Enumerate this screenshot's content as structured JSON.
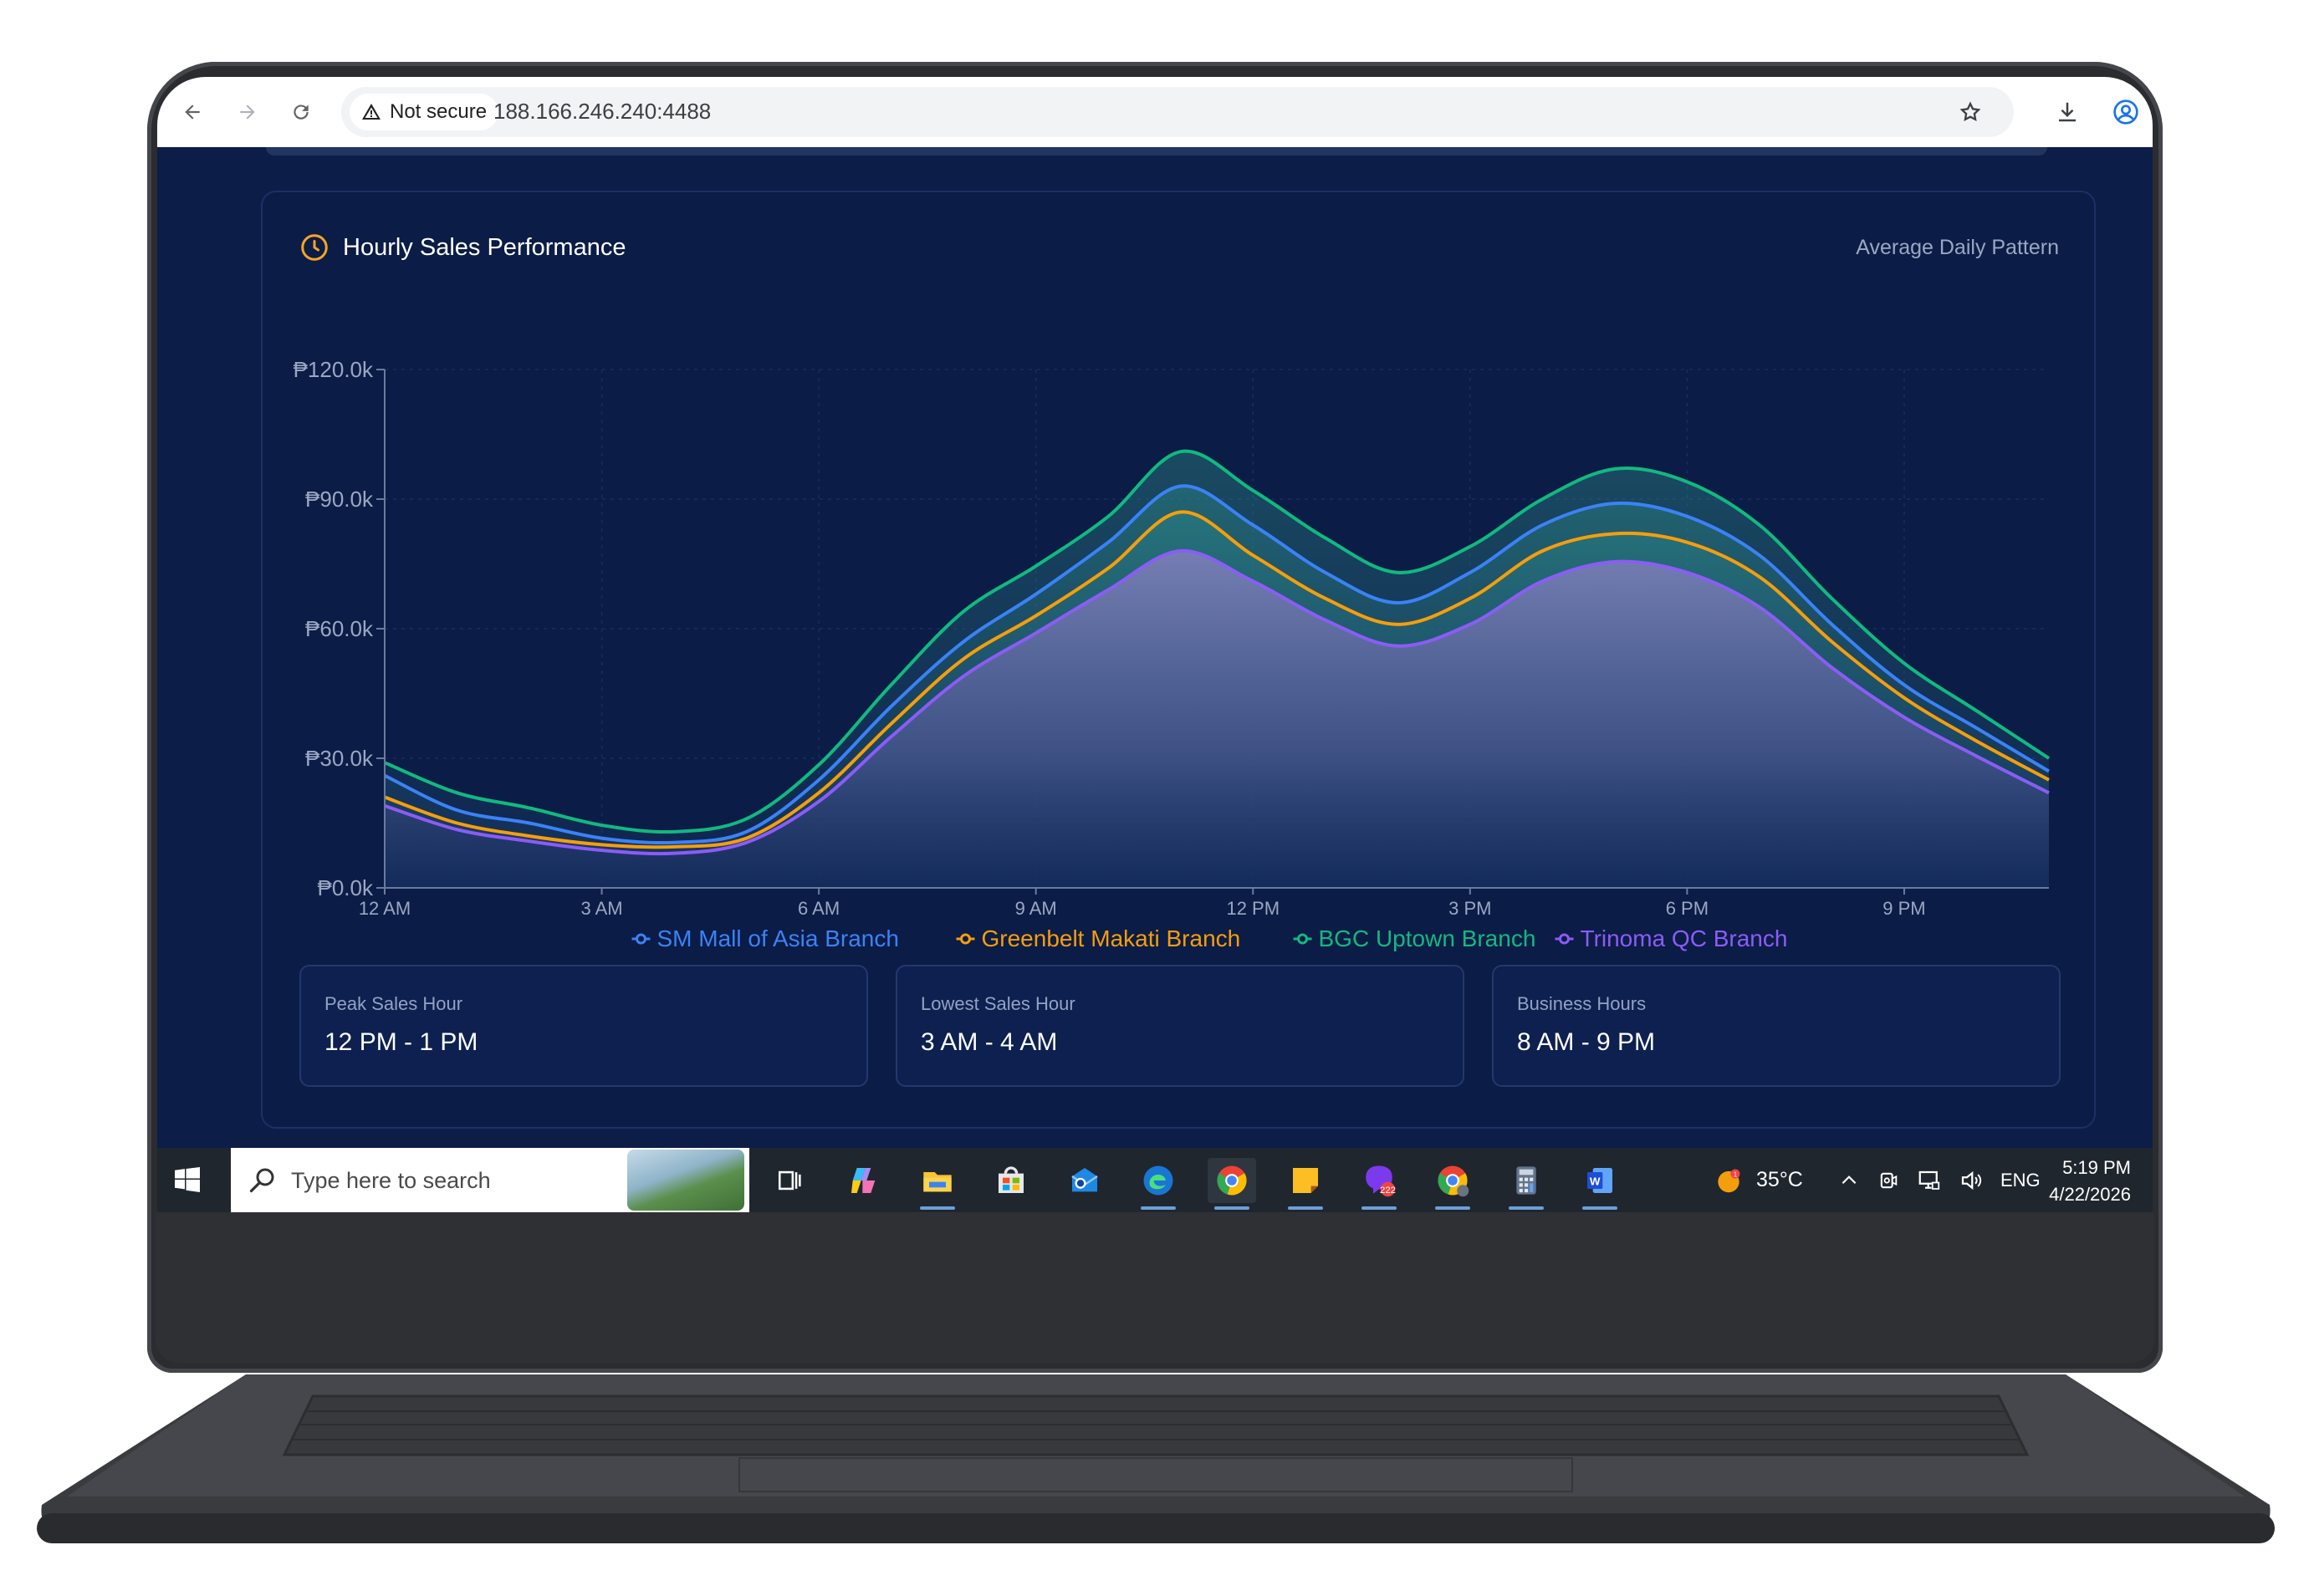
{
  "browser": {
    "security_label": "Not secure",
    "url": "188.166.246.240:4488"
  },
  "dashboard": {
    "title": "Hourly Sales Performance",
    "subtitle": "Average Daily Pattern",
    "stats": [
      {
        "label": "Peak Sales Hour",
        "value": "12 PM - 1 PM"
      },
      {
        "label": "Lowest Sales Hour",
        "value": "3 AM - 4 AM"
      },
      {
        "label": "Business Hours",
        "value": "8 AM - 9 PM"
      }
    ]
  },
  "chart_data": {
    "type": "area",
    "title": "Hourly Sales Performance",
    "subtitle": "Average Daily Pattern",
    "xlabel": "",
    "ylabel": "",
    "x_hours": [
      0,
      1,
      2,
      3,
      4,
      5,
      6,
      7,
      8,
      9,
      10,
      11,
      12,
      13,
      14,
      15,
      16,
      17,
      18,
      19,
      20,
      21,
      22,
      23
    ],
    "x_ticks": [
      {
        "hour": 0,
        "label": "12 AM"
      },
      {
        "hour": 3,
        "label": "3 AM"
      },
      {
        "hour": 6,
        "label": "6 AM"
      },
      {
        "hour": 9,
        "label": "9 AM"
      },
      {
        "hour": 12,
        "label": "12 PM"
      },
      {
        "hour": 15,
        "label": "3 PM"
      },
      {
        "hour": 18,
        "label": "6 PM"
      },
      {
        "hour": 21,
        "label": "9 PM"
      }
    ],
    "y_ticks": [
      {
        "value": 0,
        "label": "₱0.0k"
      },
      {
        "value": 30000,
        "label": "₱30.0k"
      },
      {
        "value": 60000,
        "label": "₱60.0k"
      },
      {
        "value": 90000,
        "label": "₱90.0k"
      },
      {
        "value": 120000,
        "label": "₱120.0k"
      }
    ],
    "ylim": [
      0,
      120000
    ],
    "grid": true,
    "legend_position": "bottom",
    "series": [
      {
        "name": "SM Mall of Asia Branch",
        "color": "#3b82f6",
        "values": [
          26000,
          18000,
          15000,
          11500,
          10500,
          13000,
          25000,
          42000,
          57000,
          68000,
          80000,
          93000,
          84000,
          73000,
          66000,
          73000,
          84000,
          89000,
          86000,
          77000,
          61000,
          47000,
          37000,
          27000
        ]
      },
      {
        "name": "Greenbelt Makati Branch",
        "color": "#f59e0b",
        "values": [
          21000,
          15000,
          12000,
          10000,
          9500,
          11500,
          22000,
          38000,
          53000,
          63000,
          74000,
          87000,
          77000,
          67000,
          61000,
          67000,
          78000,
          82000,
          80000,
          72000,
          57000,
          44000,
          34000,
          25000
        ]
      },
      {
        "name": "BGC Uptown Branch",
        "color": "#10b981",
        "values": [
          29000,
          22000,
          18500,
          14500,
          13000,
          16000,
          28500,
          47000,
          64000,
          74500,
          86000,
          101000,
          92000,
          81000,
          73000,
          79000,
          90000,
          97000,
          94000,
          84000,
          67000,
          52000,
          41000,
          30000
        ]
      },
      {
        "name": "Trinoma QC Branch",
        "color": "#8b5cf6",
        "values": [
          19000,
          13500,
          10800,
          8700,
          8000,
          10500,
          20000,
          35000,
          49000,
          59000,
          69000,
          78000,
          71000,
          62000,
          56000,
          61000,
          71000,
          75500,
          73000,
          65000,
          51000,
          39500,
          30500,
          22000
        ]
      }
    ]
  },
  "taskbar": {
    "search_placeholder": "Type here to search",
    "temperature": "35°C",
    "language": "ENG",
    "time": "5:19 PM",
    "date": "4/22/2026",
    "chrome_badge": "1"
  }
}
